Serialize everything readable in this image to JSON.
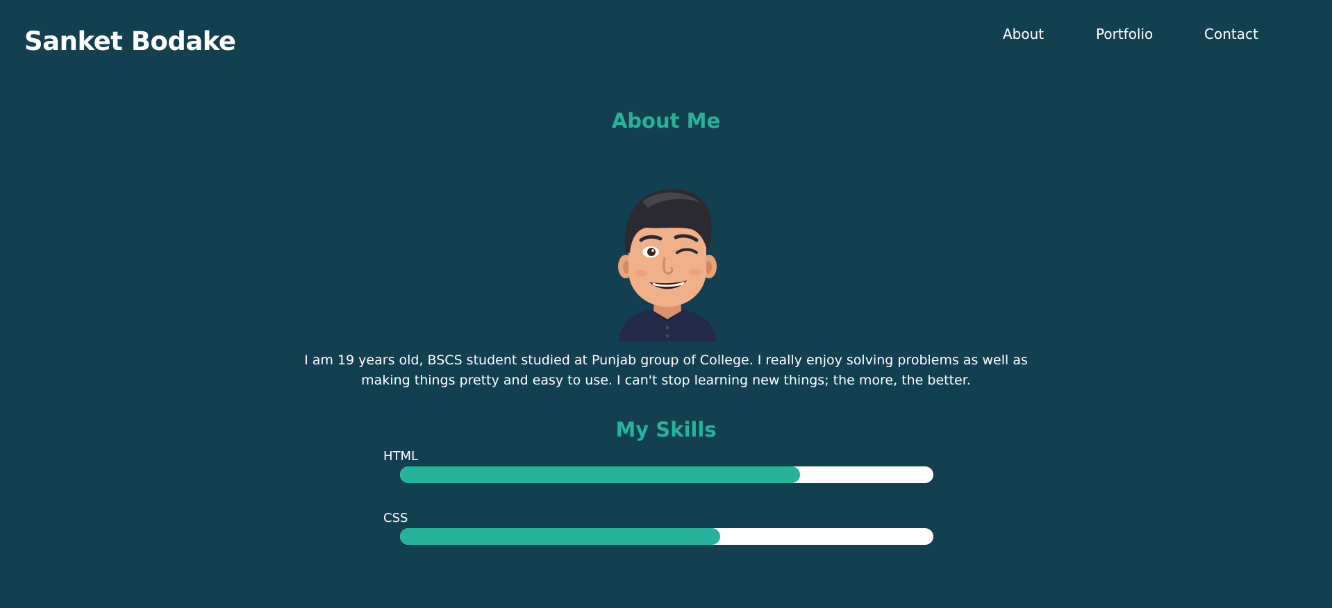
{
  "header": {
    "brand": "Sanket Bodake"
  },
  "nav": {
    "items": [
      {
        "label": "About"
      },
      {
        "label": "Portfolio"
      },
      {
        "label": "Contact"
      }
    ]
  },
  "about": {
    "title": "About Me",
    "avatar_icon": "winking-avatar-icon",
    "bio": "I am 19 years old, BSCS student studied at Punjab group of College. I really enjoy solving problems as well as making things pretty and easy to use. I can't stop learning new things; the more, the better."
  },
  "skills": {
    "title": "My Skills",
    "items": [
      {
        "label": "HTML",
        "level": 0.75
      },
      {
        "label": "CSS",
        "level": 0.6
      }
    ]
  },
  "colors": {
    "background": "#134050",
    "accent": "#26b39c",
    "text": "#ffffff",
    "bar_track": "#ffffff"
  }
}
